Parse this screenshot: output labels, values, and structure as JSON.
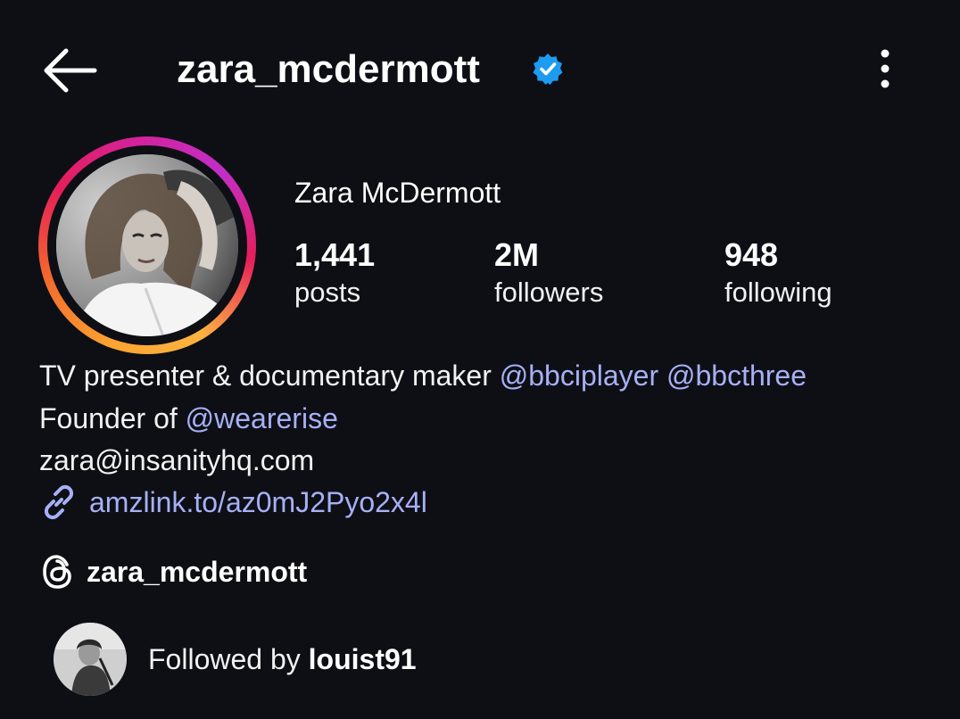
{
  "header": {
    "username": "zara_mcdermott",
    "back_icon": "arrow-left-icon",
    "verified_icon": "verified-badge-icon",
    "more_icon": "more-vertical-icon"
  },
  "profile": {
    "display_name": "Zara McDermott",
    "stats": [
      {
        "value": "1,441",
        "label": "posts"
      },
      {
        "value": "2M",
        "label": "followers"
      },
      {
        "value": "948",
        "label": "following"
      }
    ]
  },
  "bio": {
    "line1_text": "TV presenter & documentary maker ",
    "line1_mentions": [
      "@bbciplayer",
      "@bbcthree"
    ],
    "line2_text": "Founder of ",
    "line2_mention": "@wearerise",
    "email": "zara@insanityhq.com",
    "link": "amzlink.to/az0mJ2Pyo2x4l"
  },
  "threads": {
    "handle": "zara_mcdermott",
    "icon": "threads-icon"
  },
  "followed_by": {
    "prefix": "Followed by ",
    "user": "louist91"
  },
  "colors": {
    "background": "#0d0f15",
    "link": "#a7b0f5",
    "verified": "#1d9bf0"
  }
}
